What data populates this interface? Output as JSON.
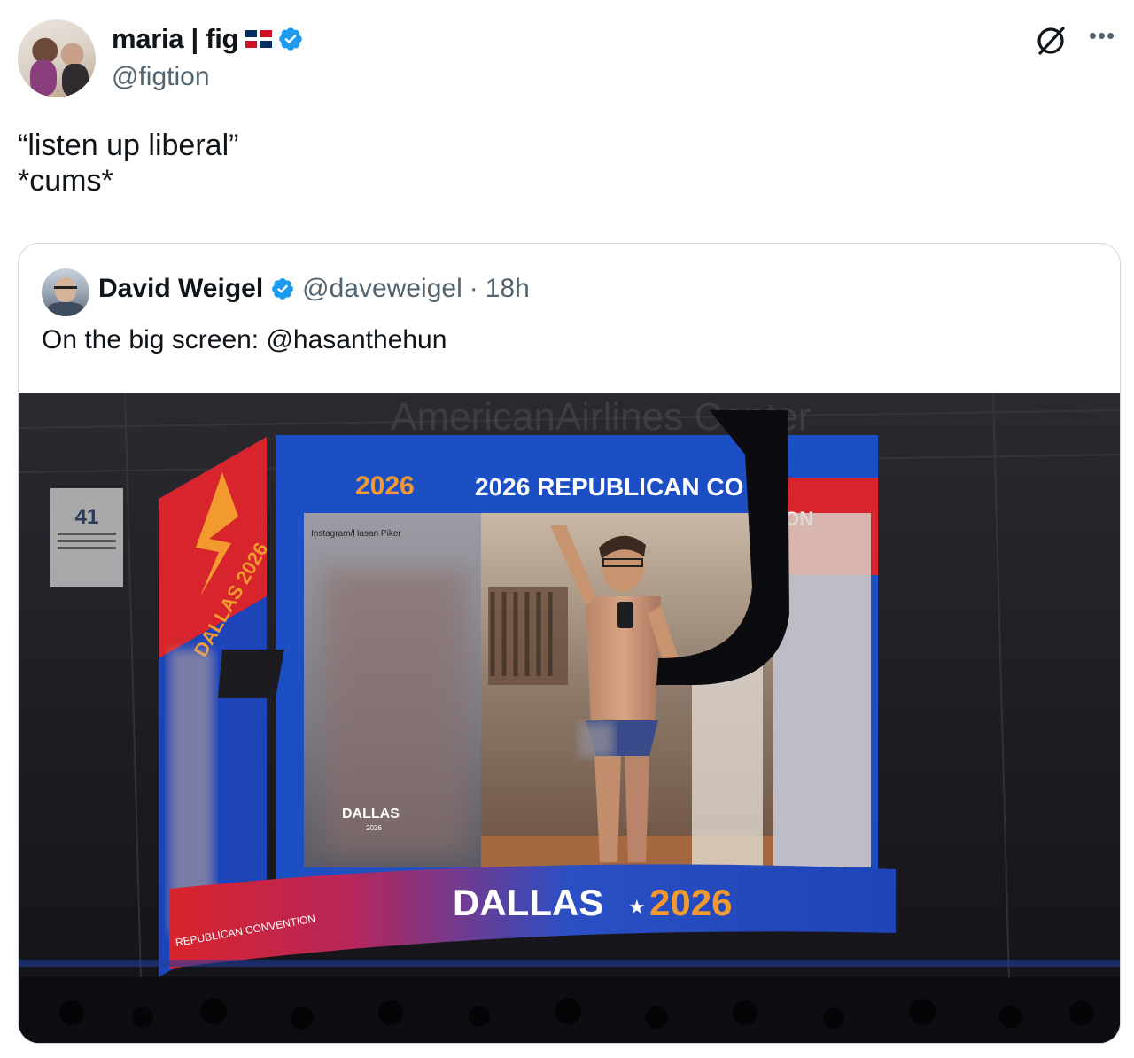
{
  "author": {
    "display_name": "maria | fig",
    "flag_icon": "dominican-republic-flag-icon",
    "verified_icon": "verified-badge-icon",
    "handle": "@figtion"
  },
  "actions": {
    "grok_icon": "grok-icon",
    "more_icon": "more-options-icon"
  },
  "tweet": {
    "lines": [
      "“listen up liberal”",
      "*cums*"
    ]
  },
  "quoted_tweet": {
    "display_name": "David Weigel",
    "verified_icon": "verified-badge-icon",
    "handle": "@daveweigel",
    "separator": "·",
    "time": "18h",
    "text": "On the big screen: @hasanthehun"
  },
  "photo": {
    "description_icon": "arena-jumbotron-photo",
    "screen_header": "2026 REPUBLICAN CO",
    "screen_header_end": "ION",
    "screen_caption": "Instagram/Hasan Piker",
    "screen_logo": "DALLAS",
    "screen_logo_year": "2026",
    "ribbon_left": "DALLAS 2026",
    "band_city": "DALLAS",
    "band_star": "★",
    "band_year": "2026",
    "band_convention": "REPUBLICAN CONVENTION",
    "banner_number": "41",
    "arena_sign": "AmericanAirlines Center",
    "colors": {
      "blue": "#1d4fc4",
      "red": "#d8242c",
      "orange": "#f39a2e",
      "verified": "#1d9bf0"
    }
  }
}
